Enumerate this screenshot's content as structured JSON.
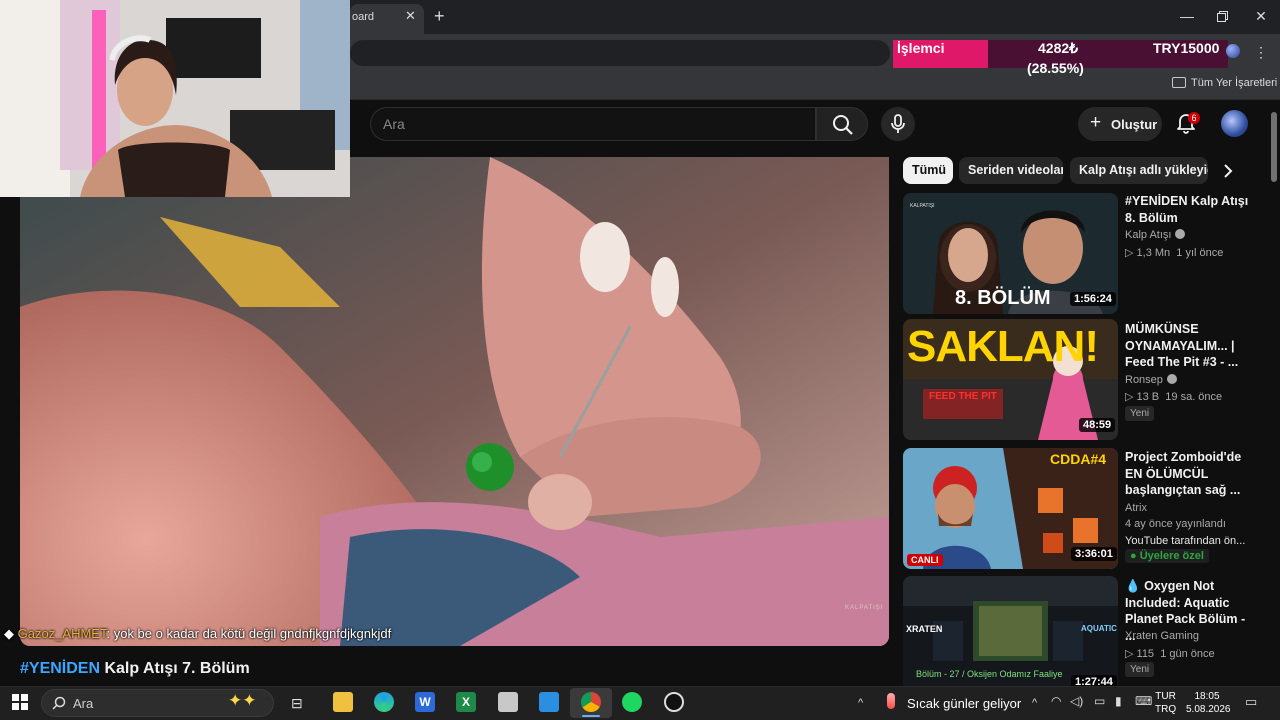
{
  "browser": {
    "tab_title": "oard",
    "bookmarks_label": "Tüm Yer İşaretleri"
  },
  "cpu_overlay": {
    "label": "İşlemci",
    "value": "4282₺",
    "percent": "(28.55%)",
    "price": "TRY15000"
  },
  "youtube": {
    "search_placeholder": "Ara",
    "create_label": "Oluştur",
    "notification_count": "6",
    "chips": [
      "Tümü",
      "Seriden videolar",
      "Kalp Atışı adlı yükleyici"
    ]
  },
  "player": {
    "watermark": "KALPATIŞI",
    "chat": {
      "username": "Gazoz_AHMET",
      "message": ": yok be o kadar da kötü değil gndnfjkgnfdjkgnkjdf"
    },
    "title_hashtag": "#YENİDEN",
    "title_rest": " Kalp Atışı 7. Bölüm"
  },
  "suggestions": [
    {
      "title": "#YENİDEN Kalp Atışı 8. Bölüm",
      "channel": "Kalp Atışı",
      "views": "1,3 Mn",
      "age": "1 yıl önce",
      "duration": "1:56:24",
      "thumb_text": "8. BÖLÜM",
      "thumb_small": "KALPATIŞI"
    },
    {
      "title": "MÜMKÜNSE OYNAMAYALIM... | Feed The Pit #3 - ...",
      "channel": "Ronsep",
      "views": "13 B",
      "age": "19 sa. önce",
      "badge": "Yeni",
      "duration": "48:59",
      "thumb_text": "SAKLAN!",
      "thumb_small": "FEED THE PIT"
    },
    {
      "title": "Project Zomboid'de EN ÖLÜMCÜL başlangıçtan sağ ...",
      "channel": "Atrix",
      "meta1": "4 ay önce yayınlandı",
      "meta2": "YouTube tarafından ön...",
      "members": "Üyelere özel",
      "duration": "3:36:01",
      "thumb_text": "CDDA#4",
      "live": "CANLI"
    },
    {
      "title": "Oxygen Not Included: Aquatic Planet Pack  Bölüm - ...",
      "channel": "Xraten Gaming",
      "views": "115",
      "age": "1 gün önce",
      "badge": "Yeni",
      "duration": "1:27:44",
      "thumb_left": "XRATEN",
      "thumb_right": "AQUATIC",
      "thumb_caption": "Bölüm - 27 / Oksijen Odamız Faaliye"
    }
  ],
  "taskbar": {
    "search_placeholder": "Ara",
    "weather": "Sıcak günler geliyor",
    "lang_top": "TUR",
    "lang_bottom": "TRQ",
    "time": "18:05",
    "date": "5.08.2026"
  }
}
